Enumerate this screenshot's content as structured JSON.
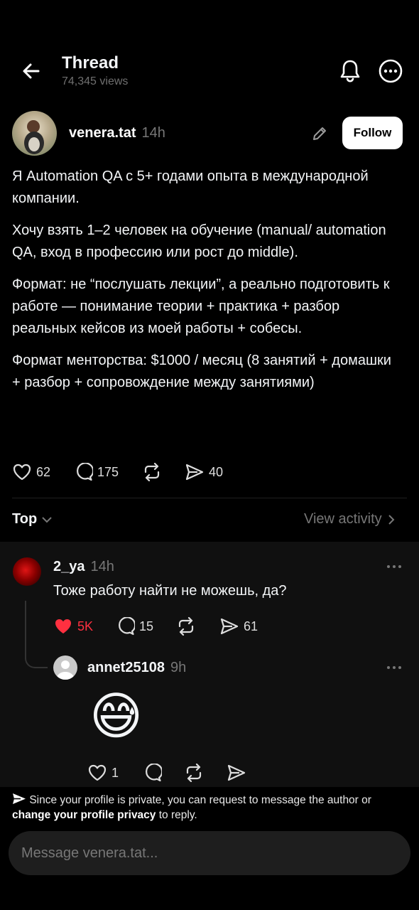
{
  "header": {
    "title": "Thread",
    "views": "74,345 views"
  },
  "post": {
    "author": "venera.tat",
    "time": "14h",
    "follow_label": "Follow",
    "paragraphs": [
      "Я Automation QA с 5+ годами опыта в международной компании.",
      "Хочу взять 1–2 человек на обучение (manual/ automation QA, вход в профессию или рост до middle).",
      "Формат: не “послушать лекции”, а реально подготовить к работе — понимание теории + практика + разбор реальных кейсов из моей работы + собесы.",
      "Формат менторства: $1000 / месяц (8 занятий + домашки + разбор + сопровождение между занятиями)"
    ],
    "likes": "62",
    "comments": "175",
    "shares": "40"
  },
  "sort": {
    "label": "Top",
    "view_activity": "View activity"
  },
  "comments": [
    {
      "author": "2_ya",
      "time": "14h",
      "text": "Тоже работу найти не можешь, да?",
      "likes": "5K",
      "replies": "15",
      "shares": "61"
    },
    {
      "author": "annet25108",
      "time": "9h",
      "emoji": "😅",
      "likes": "1"
    }
  ],
  "privacy_notice": {
    "text1": "Since your profile is private, you can request to message the author or ",
    "link": "change your profile privacy",
    "text2": " to reply."
  },
  "composer": {
    "placeholder": "Message venera.tat..."
  },
  "colors": {
    "background": "#000000",
    "comment_bg": "#101010",
    "liked": "#ff3040",
    "muted": "#777777"
  }
}
